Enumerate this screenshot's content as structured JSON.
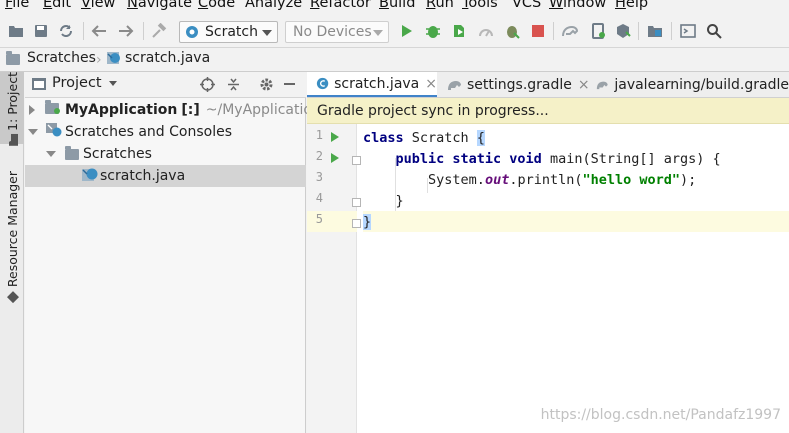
{
  "menu": [
    {
      "label": "File",
      "mnemonic": "F",
      "rest": "ile"
    },
    {
      "label": "Edit",
      "mnemonic": "E",
      "rest": "dit"
    },
    {
      "label": "View",
      "mnemonic": "V",
      "rest": "iew"
    },
    {
      "label": "Navigate",
      "mnemonic": "N",
      "rest": "avigate"
    },
    {
      "label": "Code",
      "mnemonic": "C",
      "rest": "ode"
    },
    {
      "label": "Analyze",
      "mnemonic": "",
      "rest": "Analyze"
    },
    {
      "label": "Refactor",
      "mnemonic": "R",
      "rest": "efactor"
    },
    {
      "label": "Build",
      "mnemonic": "B",
      "rest": "uild"
    },
    {
      "label": "Run",
      "mnemonic": "R",
      "rest": "un"
    },
    {
      "label": "Tools",
      "mnemonic": "T",
      "rest": "ools"
    },
    {
      "label": "VCS",
      "mnemonic": "",
      "rest": "VCS"
    },
    {
      "label": "Window",
      "mnemonic": "W",
      "rest": "indow"
    },
    {
      "label": "Help",
      "mnemonic": "H",
      "rest": "elp"
    }
  ],
  "toolbar": {
    "run_config": "Scratch",
    "device": "No Devices"
  },
  "breadcrumb": {
    "root": "Scratches",
    "file": "scratch.java"
  },
  "tool_strip": {
    "project_tab": "1: Project",
    "resource_tab": "Resource Manager"
  },
  "project_panel": {
    "title": "Project",
    "tree": [
      {
        "label": "MyApplication",
        "suffix": "[:]",
        "path": "~/MyApplication"
      },
      {
        "label": "Scratches and Consoles"
      },
      {
        "label": "Scratches"
      },
      {
        "label": "scratch.java"
      }
    ]
  },
  "editor": {
    "tabs": [
      {
        "label": "scratch.java",
        "close": "×"
      },
      {
        "label": "settings.gradle",
        "close": "×"
      },
      {
        "label": "javalearning/build.gradle"
      }
    ],
    "banner": "Gradle project sync in progress...",
    "line_numbers": [
      "1",
      "2",
      "3",
      "4",
      "5"
    ],
    "code": {
      "l1_kw": "class",
      "l1_name": " Scratch ",
      "l1_brace": "{",
      "l2_indent": "    ",
      "l2_kw": "public static void",
      "l2_rest": " main(String[] args) {",
      "l3_indent": "        ",
      "l3_pre": "System.",
      "l3_field": "out",
      "l3_mid": ".println(",
      "l3_str": "\"hello word\"",
      "l3_end": ");",
      "l4": "    }",
      "l5_brace": "}"
    }
  },
  "watermark": "https://blog.csdn.net/Pandafz1997",
  "colors": {
    "accent": "#4083c9",
    "keyword": "#000080",
    "string": "#008000",
    "run_green": "#4aa84a",
    "stop_red": "#d9534f"
  }
}
